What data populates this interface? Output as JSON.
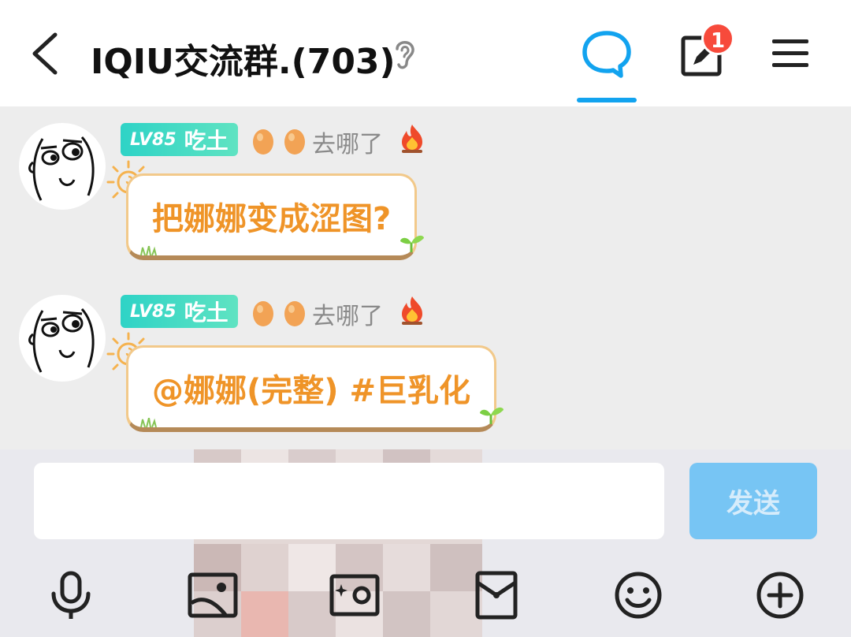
{
  "header": {
    "title": "IQIU交流群.(703)",
    "badge_count": "1"
  },
  "messages": [
    {
      "level": "LV85",
      "nickname": "吃土",
      "status": "去哪了",
      "text": "把娜娜变成涩图?"
    },
    {
      "level": "LV85",
      "nickname": "吃土",
      "status": "去哪了",
      "text": "@娜娜(完整) #巨乳化"
    }
  ],
  "composer": {
    "input_value": "",
    "send_label": "发送"
  },
  "toolbar": {
    "items": [
      "microphone-icon",
      "image-icon",
      "camera-icon",
      "red-packet-icon",
      "emoji-icon",
      "plus-icon"
    ]
  },
  "colors": {
    "accent_blue": "#12a3ef",
    "badge_red": "#f74a3b",
    "bubble_text_orange": "#ef9428",
    "level_badge_teal": "#2ed3c6",
    "send_button": "#77c5f4"
  }
}
